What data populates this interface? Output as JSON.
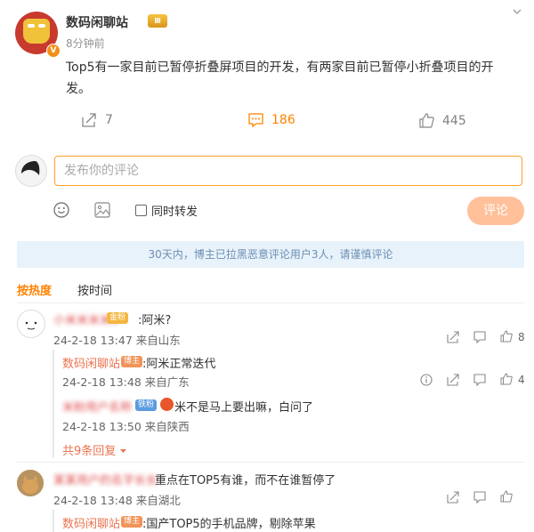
{
  "post": {
    "author": "数码闲聊站",
    "level_badge": "Ⅲ",
    "verified_badge": "V",
    "time": "8分钟前",
    "text": "Top5有一家目前已暂停折叠屏项目的开发，有两家目前已暂停小折叠项目的开发。",
    "actions": {
      "share": "7",
      "comments": "186",
      "likes": "445"
    }
  },
  "composer": {
    "placeholder": "发布你的评论",
    "forward_label": "同时转发",
    "submit_label": "评论"
  },
  "notice": "30天内，博主已拉黑恶意评论用户3人，请谨慎评论",
  "sort": {
    "hot": "按热度",
    "time": "按时间"
  },
  "comments": [
    {
      "user": "小米米米米5",
      "user_badge": "金粉",
      "text": ":阿米?",
      "meta": "24-2-18 13:47 来自山东",
      "likes": "8",
      "replies": [
        {
          "user": "数码闲聊站",
          "badge": "博主",
          "text": ":阿米正常迭代",
          "meta": "24-2-18 13:48 来自广东",
          "likes": "4"
        },
        {
          "user": "米粉用户名称",
          "badge": "铁粉",
          "text": "米不是马上要出嘛，白问了",
          "meta": "24-2-18 13:50 来自陕西"
        }
      ],
      "more_replies": "共9条回复"
    },
    {
      "user": "某某用户的名字长长",
      "text": "重点在TOP5有谁，而不在谁暂停了",
      "meta": "24-2-18 13:48 来自湖北",
      "replies": [
        {
          "user": "数码闲聊站",
          "badge": "博主",
          "text": ":国产TOP5的手机品牌，剔除苹果"
        }
      ]
    }
  ],
  "colors": {
    "accent": "#ff8200",
    "link": "#eb7350",
    "notice_bg": "#e8f2fb"
  }
}
